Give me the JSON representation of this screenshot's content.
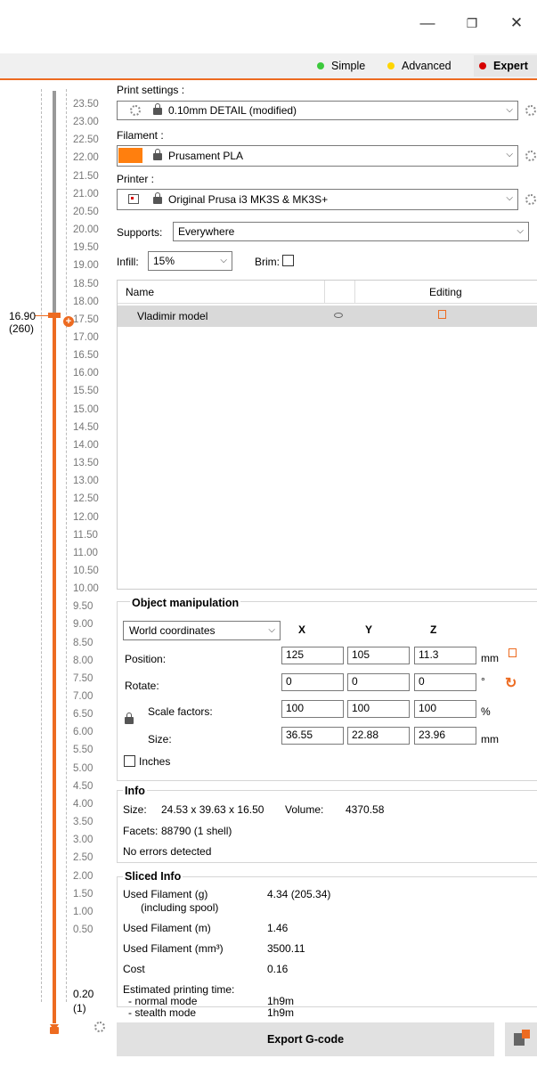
{
  "window": {
    "minimize": "—",
    "restore": "❐",
    "close": "✕"
  },
  "modes": {
    "simple": "Simple",
    "advanced": "Advanced",
    "expert": "Expert",
    "colors": {
      "simple": "#3cc93c",
      "advanced": "#ffd500",
      "expert": "#d60000"
    }
  },
  "accent": "#ed6b21",
  "layer_slider": {
    "top_value": "16.90",
    "top_layer": "(260)",
    "bottom_value": "0.20",
    "bottom_layer": "(1)",
    "ticks": [
      "23.50",
      "23.00",
      "22.50",
      "22.00",
      "21.50",
      "21.00",
      "20.50",
      "20.00",
      "19.50",
      "19.00",
      "18.50",
      "18.00",
      "17.50",
      "17.00",
      "16.50",
      "16.00",
      "15.50",
      "15.00",
      "14.50",
      "14.00",
      "13.50",
      "13.00",
      "12.50",
      "12.00",
      "11.50",
      "11.00",
      "10.50",
      "10.00",
      "9.50",
      "9.00",
      "8.50",
      "8.00",
      "7.50",
      "7.00",
      "6.50",
      "6.00",
      "5.50",
      "5.00",
      "4.50",
      "4.00",
      "3.50",
      "3.00",
      "2.50",
      "2.00",
      "1.50",
      "1.00",
      "0.50"
    ]
  },
  "print_settings": {
    "label": "Print settings :",
    "value": "0.10mm DETAIL (modified)"
  },
  "filament": {
    "label": "Filament :",
    "value": "Prusament PLA",
    "color": "#ff7f0e"
  },
  "printer": {
    "label": "Printer :",
    "value": "Original Prusa i3 MK3S & MK3S+"
  },
  "supports": {
    "label": "Supports:",
    "value": "Everywhere"
  },
  "infill": {
    "label": "Infill:",
    "value": "15%"
  },
  "brim": {
    "label": "Brim:",
    "checked": false
  },
  "object_list": {
    "col_name": "Name",
    "col_editing": "Editing",
    "rows": [
      {
        "name": "Vladimir model"
      }
    ]
  },
  "object_manipulation": {
    "title": "Object manipulation",
    "coords": "World coordinates",
    "x": "X",
    "y": "Y",
    "z": "Z",
    "position": {
      "label": "Position:",
      "x": "125",
      "y": "105",
      "z": "11.3",
      "unit": "mm"
    },
    "rotate": {
      "label": "Rotate:",
      "x": "0",
      "y": "0",
      "z": "0",
      "unit": "°"
    },
    "scale": {
      "label": "Scale factors:",
      "x": "100",
      "y": "100",
      "z": "100",
      "unit": "%"
    },
    "size": {
      "label": "Size:",
      "x": "36.55",
      "y": "22.88",
      "z": "23.96",
      "unit": "mm"
    },
    "inches": "Inches"
  },
  "info": {
    "title": "Info",
    "size_label": "Size:",
    "size_value": "24.53 x 39.63 x 16.50",
    "volume_label": "Volume:",
    "volume_value": "4370.58",
    "facets_label": "Facets:",
    "facets_value": "88790 (1 shell)",
    "errors": "No errors detected"
  },
  "sliced_info": {
    "title": "Sliced Info",
    "used_g_label": "Used Filament (g)",
    "used_g_sub": "(including spool)",
    "used_g_value": "4.34 (205.34)",
    "used_m_label": "Used Filament (m)",
    "used_m_value": "1.46",
    "used_mm3_label": "Used Filament (mm³)",
    "used_mm3_value": "3500.11",
    "cost_label": "Cost",
    "cost_value": "0.16",
    "est_label": "Estimated printing time:",
    "normal_label": "- normal mode",
    "normal_value": "1h9m",
    "stealth_label": "- stealth mode",
    "stealth_value": "1h9m"
  },
  "export_button": "Export G-code"
}
